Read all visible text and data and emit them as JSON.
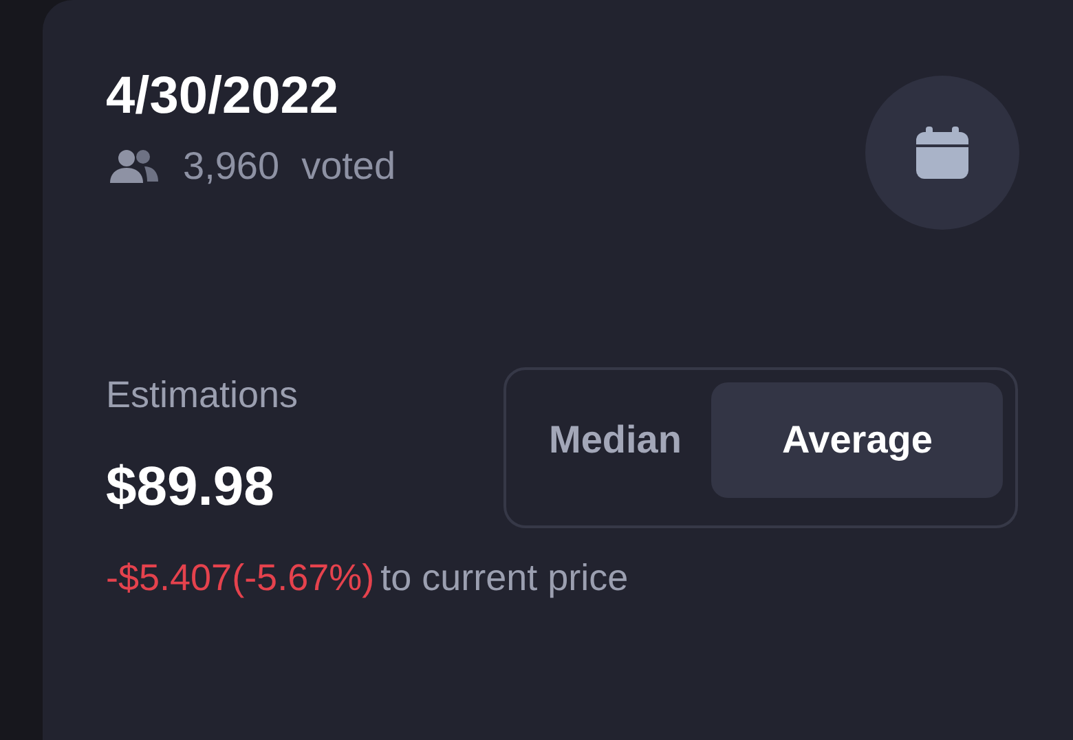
{
  "header": {
    "date": "4/30/2022",
    "votes": "3,960",
    "votes_label": "voted"
  },
  "estimations": {
    "label": "Estimations",
    "value": "$89.98",
    "change": "-$5.407(-5.67%)",
    "change_suffix": "to current price",
    "options": [
      {
        "label": "Median",
        "selected": false
      },
      {
        "label": "Average",
        "selected": true
      }
    ]
  }
}
